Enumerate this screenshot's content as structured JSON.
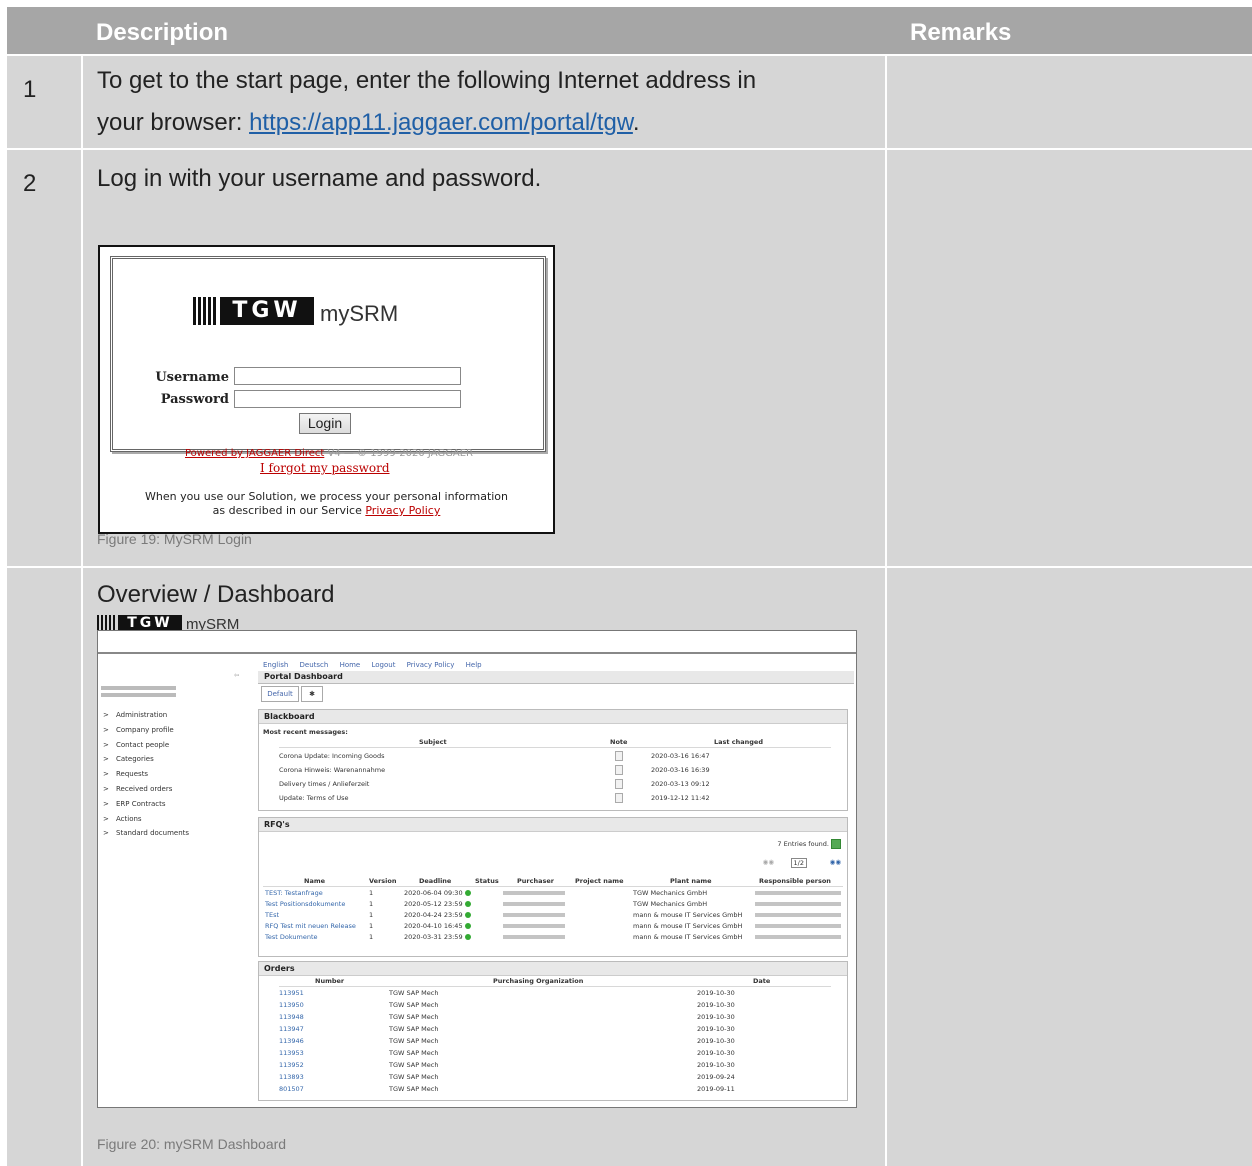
{
  "header": {
    "col1": "Description",
    "col2": "Remarks"
  },
  "rows": [
    {
      "num": "1",
      "line1": "To get to the start page, enter the following Internet address in",
      "line2_prefix": "your browser: ",
      "link": "https://app11.jaggaer.com/portal/tgw",
      "line2_suffix": "."
    },
    {
      "num": "2",
      "text": "Log in with your username and password.",
      "caption": "Figure 19: MySRM Login"
    },
    {
      "num": "",
      "text": "Overview / Dashboard",
      "caption": "Figure 20: mySRM Dashboard"
    }
  ],
  "login": {
    "logo_text": "TGW",
    "logo_suffix": "mySRM",
    "username_label": "Username",
    "password_label": "Password",
    "login_button": "Login",
    "powered": "Powered by JAGGAER Direct",
    "version": " V4 — © 1999-2020 JAGGAER",
    "forgot": "I forgot my password",
    "privacy_line1": "When you use our Solution, we process your personal information",
    "privacy_line2": "as described in our Service ",
    "privacy_link": "Privacy Policy"
  },
  "dashboard": {
    "logo_text": "TGW",
    "logo_suffix": "mySRM",
    "nav": [
      "English",
      "Deutsch",
      "Home",
      "Logout",
      "Privacy Policy",
      "Help"
    ],
    "page_title": "Portal Dashboard",
    "tab_default": "Default",
    "tab_star": "✱",
    "sidebar": [
      "Administration",
      "Company profile",
      "Contact people",
      "Categories",
      "Requests",
      "Received orders",
      "ERP Contracts",
      "Actions",
      "Standard documents"
    ],
    "blackboard": {
      "title": "Blackboard",
      "subtitle": "Most recent messages:",
      "cols": [
        "Subject",
        "Note",
        "Last changed"
      ],
      "rows": [
        {
          "subject": "Corona Update: Incoming Goods",
          "changed": "2020-03-16 16:47"
        },
        {
          "subject": "Corona Hinweis: Warenannahme",
          "changed": "2020-03-16 16:39"
        },
        {
          "subject": "Delivery times / Anlieferzeit",
          "changed": "2020-03-13 09:12"
        },
        {
          "subject": "Update: Terms of Use",
          "changed": "2019-12-12 11:42"
        }
      ]
    },
    "rfq": {
      "title": "RFQ's",
      "count": "7 Entries found.",
      "pager": "1/2",
      "cols": [
        "Name",
        "Version",
        "Deadline",
        "Status",
        "Purchaser",
        "Project name",
        "Plant name",
        "Responsible person"
      ],
      "rows": [
        {
          "name": "TEST: Testanfrage",
          "version": "1",
          "deadline": "2020-06-04 09:30",
          "plant": "TGW Mechanics GmbH"
        },
        {
          "name": "Test Positionsdokumente",
          "version": "1",
          "deadline": "2020-05-12 23:59",
          "plant": "TGW Mechanics GmbH"
        },
        {
          "name": "TEst",
          "version": "1",
          "deadline": "2020-04-24 23:59",
          "plant": "mann & mouse IT Services GmbH"
        },
        {
          "name": "RFQ Test mit neuen Release",
          "version": "1",
          "deadline": "2020-04-10 16:45",
          "plant": "mann & mouse IT Services GmbH"
        },
        {
          "name": "Test Dokumente",
          "version": "1",
          "deadline": "2020-03-31 23:59",
          "plant": "mann & mouse IT Services GmbH"
        }
      ]
    },
    "orders": {
      "title": "Orders",
      "cols": [
        "Number",
        "Purchasing Organization",
        "Date"
      ],
      "rows": [
        {
          "number": "113951",
          "org": "TGW SAP Mech",
          "date": "2019-10-30"
        },
        {
          "number": "113950",
          "org": "TGW SAP Mech",
          "date": "2019-10-30"
        },
        {
          "number": "113948",
          "org": "TGW SAP Mech",
          "date": "2019-10-30"
        },
        {
          "number": "113947",
          "org": "TGW SAP Mech",
          "date": "2019-10-30"
        },
        {
          "number": "113946",
          "org": "TGW SAP Mech",
          "date": "2019-10-30"
        },
        {
          "number": "113953",
          "org": "TGW SAP Mech",
          "date": "2019-10-30"
        },
        {
          "number": "113952",
          "org": "TGW SAP Mech",
          "date": "2019-10-30"
        },
        {
          "number": "113893",
          "org": "TGW SAP Mech",
          "date": "2019-09-24"
        },
        {
          "number": "801507",
          "org": "TGW SAP Mech",
          "date": "2019-09-11"
        }
      ]
    }
  },
  "colors": {
    "header": "#a6a6a6",
    "row": "#d6d6d6",
    "link": "#1f5fa6",
    "accent_red": "#b00000"
  }
}
